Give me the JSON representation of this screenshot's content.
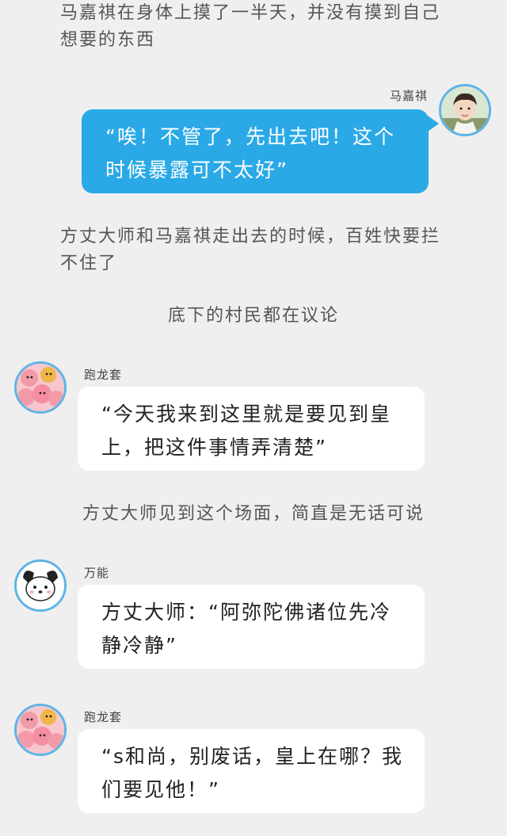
{
  "narration": {
    "n1": "马嘉祺在身体上摸了一半天，并没有摸到自己想要的东西",
    "n2": "方丈大师和马嘉祺走出去的时候，百姓快要拦不住了",
    "n3": "底下的村民都在议论",
    "n4": "方丈大师见到这个场面，简直是无话可说"
  },
  "messages": {
    "m1": {
      "name": "马嘉祺",
      "text": "“唉！不管了，先出去吧！这个时候暴露可不太好”",
      "avatar_icon": "young-man-avatar-icon"
    },
    "m2": {
      "name": "跑龙套",
      "text": "“今天我来到这里就是要见到皇上，把这件事情弄清楚”",
      "avatar_icon": "pink-bears-avatar-icon"
    },
    "m3": {
      "name": "万能",
      "text": "方丈大师：“阿弥陀佛诸位先冷静冷静”",
      "avatar_icon": "white-puppy-avatar-icon"
    },
    "m4": {
      "name": "跑龙套",
      "text": "“s和尚，别废话，皇上在哪？我们要见他！”",
      "avatar_icon": "pink-bears-avatar-icon"
    }
  },
  "colors": {
    "background": "#efeff0",
    "right_bubble": "#2aa9e6",
    "left_bubble": "#ffffff",
    "avatar_border": "#5fb4e4"
  }
}
